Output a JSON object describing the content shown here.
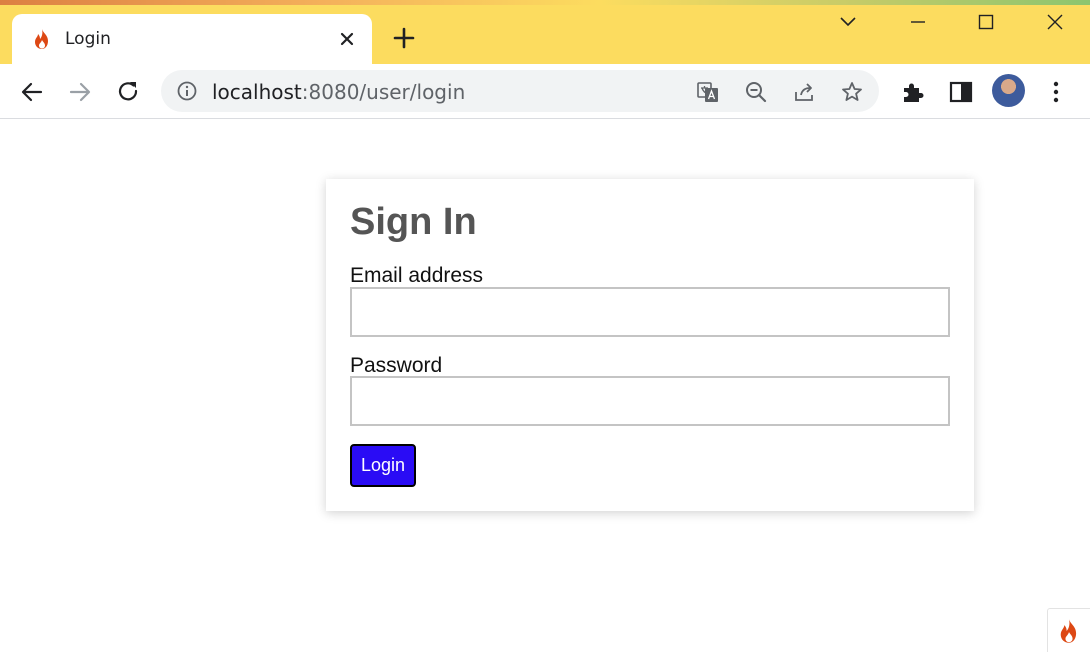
{
  "browser": {
    "tab": {
      "title": "Login",
      "favicon": "codeigniter-flame-icon"
    },
    "address_bar": {
      "host": "localhost",
      "path": ":8080/user/login"
    },
    "theme_color": "#fcdc5f"
  },
  "page": {
    "title": "Sign In",
    "email": {
      "label": "Email address",
      "value": ""
    },
    "password": {
      "label": "Password",
      "value": ""
    },
    "submit_label": "Login",
    "submit_color": "#2a0cf5"
  },
  "debug_toolbar": {
    "icon": "codeigniter-flame-icon"
  }
}
